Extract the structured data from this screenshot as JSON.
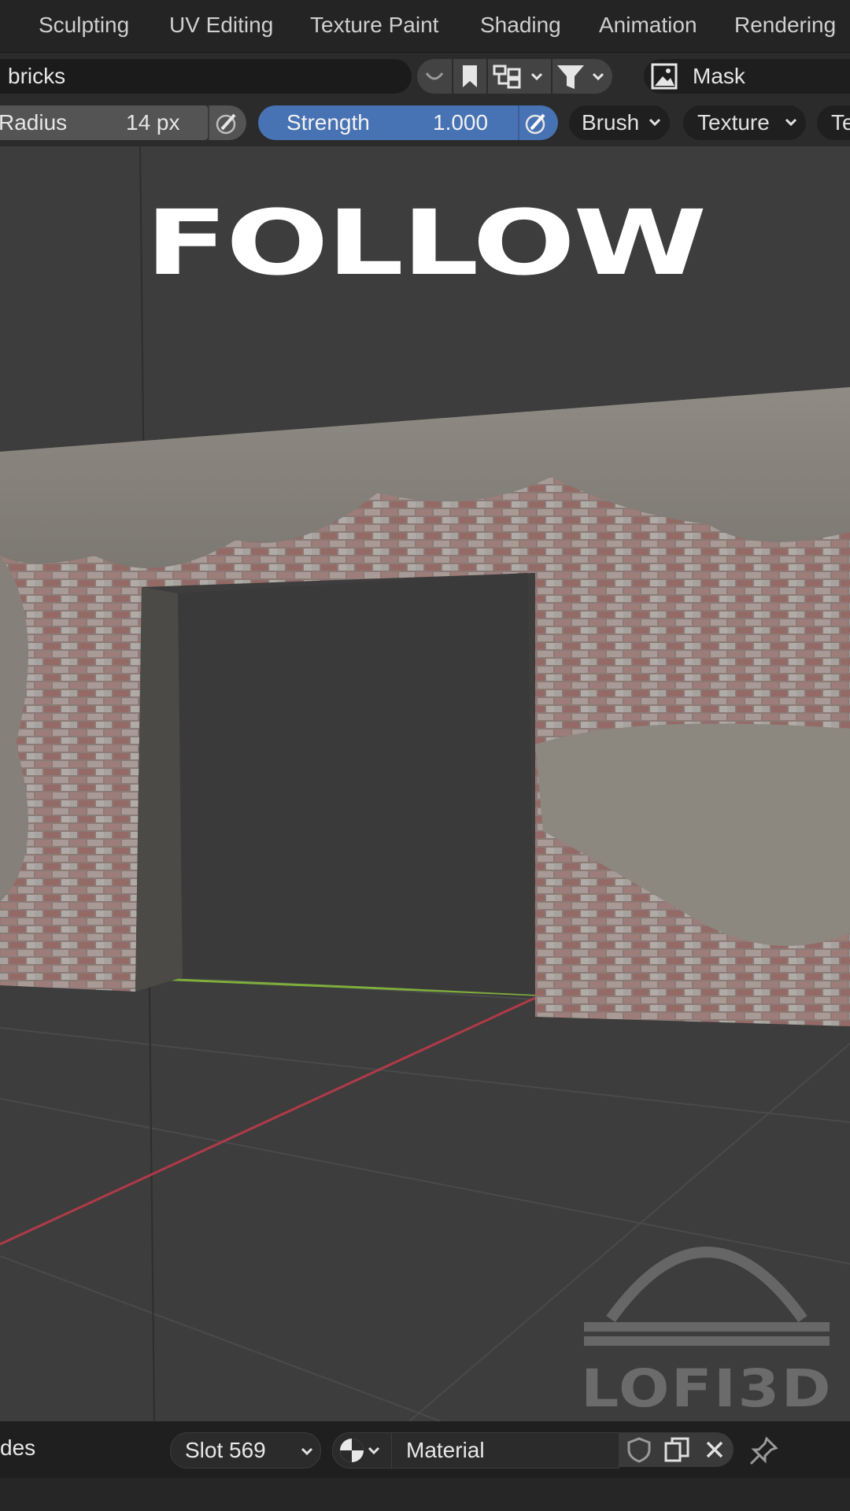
{
  "workspace_tabs": [
    "Sculpting",
    "UV Editing",
    "Texture Paint",
    "Shading",
    "Animation",
    "Rendering"
  ],
  "header": {
    "search_value": "bricks",
    "mask_label": "Mask"
  },
  "tool_settings": {
    "radius_label": "Radius",
    "radius_value": "14 px",
    "strength_label": "Strength",
    "strength_value": "1.000",
    "brush_label": "Brush",
    "texture_label": "Texture",
    "cut_label": "Te"
  },
  "viewport": {
    "overlay_title": "FOLLOW",
    "watermark_text": "LOFI3D"
  },
  "bottom_bar": {
    "left_cut_label": "des",
    "slot_label": "Slot 569",
    "material_name": "Material"
  },
  "colors": {
    "accent_blue": "#4772b3",
    "axis_x_red": "#b03a48",
    "axis_y_green": "#7fae3c"
  },
  "icons": [
    "curve-dropdown-icon",
    "bookmark-icon",
    "hierarchy-icon",
    "filter-icon",
    "image-mask-icon",
    "pen-pressure-icon",
    "material-sphere-icon",
    "shield-icon",
    "copy-icon",
    "close-icon",
    "pin-icon",
    "chevron-down-icon"
  ]
}
